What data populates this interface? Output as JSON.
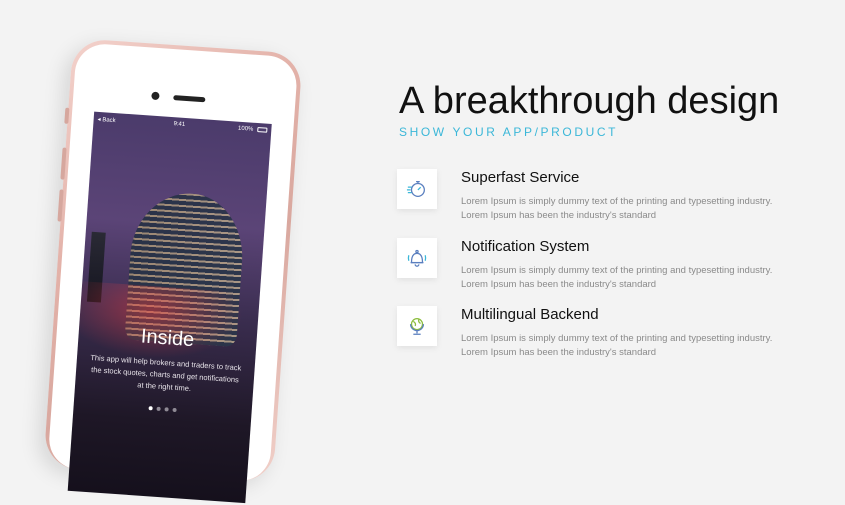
{
  "phone": {
    "status_left": "Back",
    "status_time": "9:41",
    "status_battery": "100%",
    "screen_title": "Inside",
    "screen_text": "This app will help brokers and traders to track the stock quotes, charts and get notifications at the right time.",
    "page_dots": 4,
    "active_dot": 1
  },
  "hero": {
    "title": "A breakthrough design",
    "subtitle": "SHOW YOUR APP/PRODUCT"
  },
  "features": [
    {
      "icon": "stopwatch-icon",
      "title": "Superfast Service",
      "text": "Lorem Ipsum is simply dummy text of the printing and typesetting industry. Lorem Ipsum has been the industry's standard"
    },
    {
      "icon": "bell-icon",
      "title": "Notification System",
      "text": "Lorem Ipsum is simply dummy text of the printing and typesetting industry. Lorem Ipsum has been the industry's standard"
    },
    {
      "icon": "globe-icon",
      "title": "Multilingual Backend",
      "text": "Lorem Ipsum is simply dummy text of the printing and typesetting industry. Lorem Ipsum has been the industry's standard"
    }
  ],
  "colors": {
    "accent": "#3bb7d8",
    "icon_blue": "#5a7fbf",
    "icon_green": "#8bbd3c",
    "background": "#f3f3f3"
  }
}
